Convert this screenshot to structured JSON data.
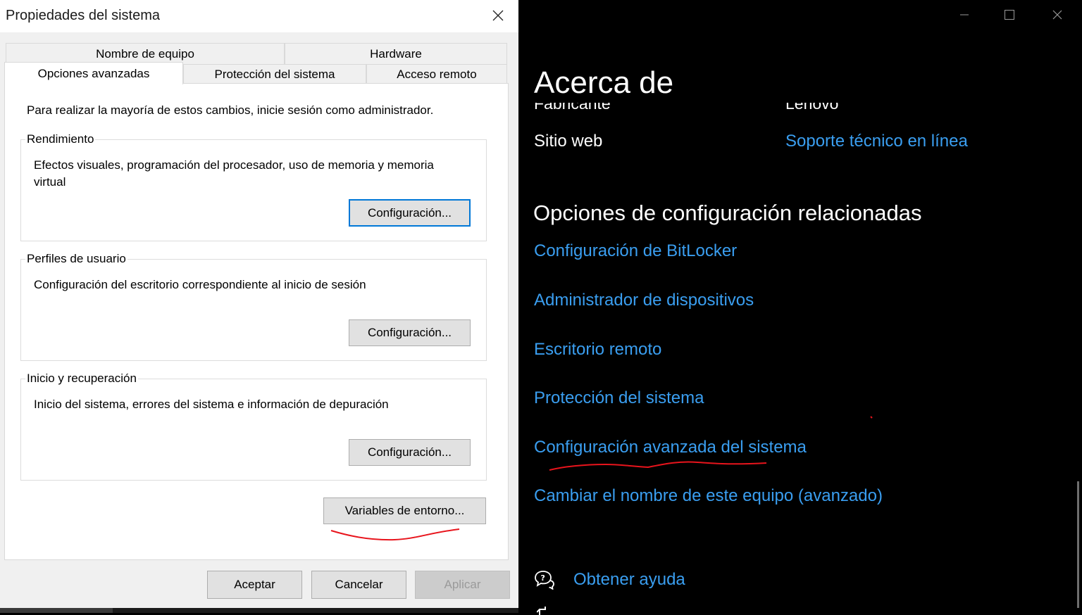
{
  "dialog": {
    "title": "Propiedades del sistema",
    "tabs_row1": [
      {
        "label": "Nombre de equipo"
      },
      {
        "label": "Hardware"
      }
    ],
    "tabs_row2": [
      {
        "label": "Opciones avanzadas",
        "active": true
      },
      {
        "label": "Protección del sistema"
      },
      {
        "label": "Acceso remoto"
      }
    ],
    "admin_note": "Para realizar la mayoría de estos cambios, inicie sesión como administrador.",
    "groups": [
      {
        "legend": "Rendimiento",
        "description": "Efectos visuales, programación del procesador, uso de memoria y memoria virtual",
        "button": "Configuración..."
      },
      {
        "legend": "Perfiles de usuario",
        "description": "Configuración del escritorio correspondiente al inicio de sesión",
        "button": "Configuración..."
      },
      {
        "legend": "Inicio y recuperación",
        "description": "Inicio del sistema, errores del sistema e información de depuración",
        "button": "Configuración..."
      }
    ],
    "env_button": "Variables de entorno...",
    "footer": {
      "ok": "Aceptar",
      "cancel": "Cancelar",
      "apply": "Aplicar"
    }
  },
  "settings": {
    "title": "Acerca de",
    "obscured_row": {
      "label": "Fabricante",
      "value": "Lenovo"
    },
    "website": {
      "label": "Sitio web",
      "link": "Soporte técnico en línea"
    },
    "related_heading": "Opciones de configuración relacionadas",
    "related_links": [
      "Configuración de BitLocker",
      "Administrador de dispositivos",
      "Escritorio remoto",
      "Protección del sistema",
      "Configuración avanzada del sistema",
      "Cambiar el nombre de este equipo (avanzado)"
    ],
    "help_link": "Obtener ayuda",
    "link_color": "#3a9ef0",
    "annotation_color": "#e8141c"
  },
  "icons": [
    "close-icon",
    "minimize-icon",
    "maximize-icon",
    "help-icon",
    "feedback-icon"
  ]
}
